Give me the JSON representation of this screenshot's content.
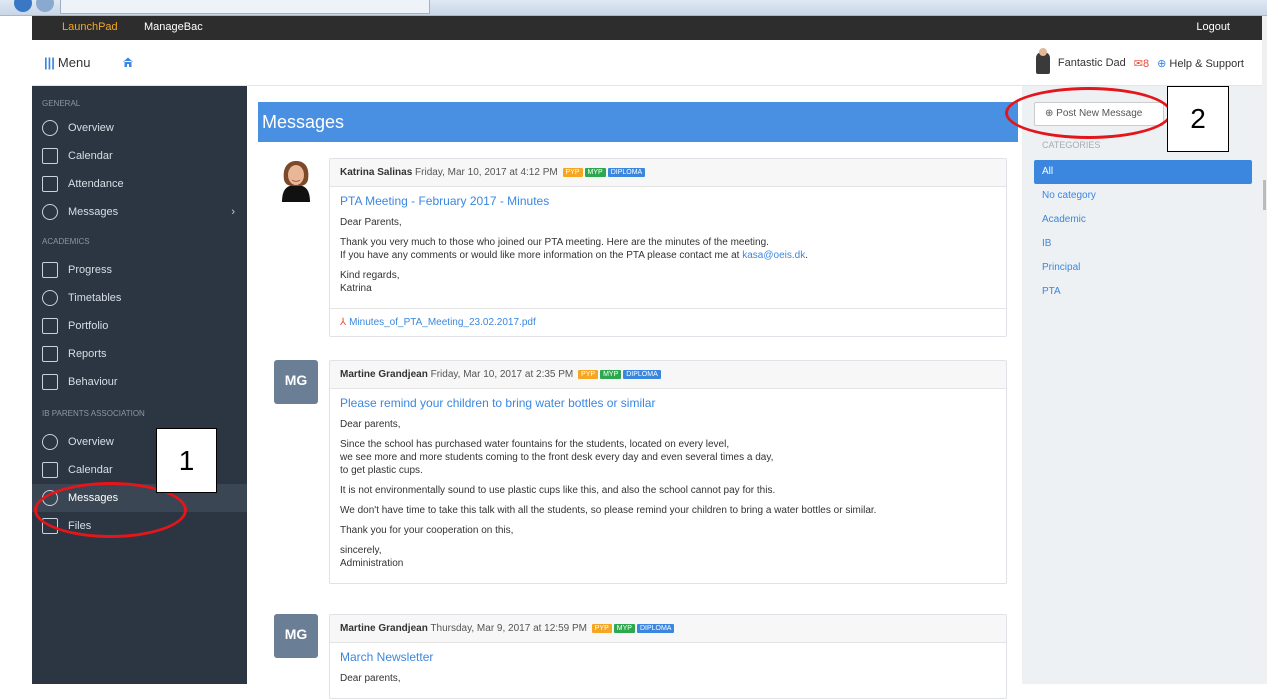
{
  "topbar": {
    "launchpad": "LaunchPad",
    "managebac": "ManageBac",
    "logout": "Logout"
  },
  "subbar": {
    "menu": "Menu",
    "user": "Fantastic Dad",
    "mail_count": "8",
    "help": "Help & Support"
  },
  "sidebar": {
    "general": "GENERAL",
    "academics": "ACADEMICS",
    "parents": "IB PARENTS ASSOCIATION",
    "general_items": [
      "Overview",
      "Calendar",
      "Attendance",
      "Messages"
    ],
    "academic_items": [
      "Progress",
      "Timetables",
      "Portfolio",
      "Reports",
      "Behaviour"
    ],
    "parent_items": [
      "Overview",
      "Calendar",
      "Messages",
      "Files"
    ]
  },
  "page": {
    "title": "Messages"
  },
  "messages": [
    {
      "author": "Katrina Salinas",
      "date": "Friday, Mar 10, 2017 at 4:12 PM",
      "tags": [
        "PYP",
        "MYP",
        "DIPLOMA"
      ],
      "title": "PTA Meeting - February 2017 - Minutes",
      "greeting": "Dear Parents,",
      "line1": "Thank you very much to those who joined our PTA meeting. Here are the minutes of the meeting.",
      "line2": "If you have any comments or would like more information on the PTA please contact me at ",
      "email": "kasa@oeis.dk",
      "line2_end": ".",
      "closing": "Kind regards,",
      "signature": "Katrina",
      "attachment": "Minutes_of_PTA_Meeting_23.02.2017.pdf"
    },
    {
      "author": "Martine Grandjean",
      "initials": "MG",
      "date": "Friday, Mar 10, 2017 at 2:35 PM",
      "tags": [
        "PYP",
        "MYP",
        "DIPLOMA"
      ],
      "title": "Please remind your children to bring water bottles or similar",
      "greeting": "Dear parents,",
      "p1a": "Since the school has purchased water fountains for the students, located on every level,",
      "p1b": "we see more and more students coming to the front desk every day and even several times a day,",
      "p1c": "to get plastic cups.",
      "p2": "It is not environmentally sound to use plastic cups like this, and also the school cannot pay for this.",
      "p3": "We don't have time to take this talk with all the students, so please remind your children to bring a water bottles or similar.",
      "p4": "Thank you for your cooperation on this,",
      "closing": "sincerely,",
      "signature": "Administration"
    },
    {
      "author": "Martine Grandjean",
      "initials": "MG",
      "date": "Thursday, Mar 9, 2017 at 12:59 PM",
      "tags": [
        "PYP",
        "MYP",
        "DIPLOMA"
      ],
      "title": "March Newsletter",
      "greeting": "Dear parents,"
    }
  ],
  "right": {
    "post_button": "Post New Message",
    "categories_label": "CATEGORIES",
    "categories": [
      "All",
      "No category",
      "Academic",
      "IB",
      "Principal",
      "PTA"
    ]
  },
  "annotations": {
    "one": "1",
    "two": "2"
  },
  "colors": {
    "accent": "#4a90e2",
    "sidebar": "#2b3642",
    "annotation": "#e3161b",
    "pyp": "#f5a623",
    "myp": "#2ea84e",
    "diploma": "#3b87e0"
  }
}
